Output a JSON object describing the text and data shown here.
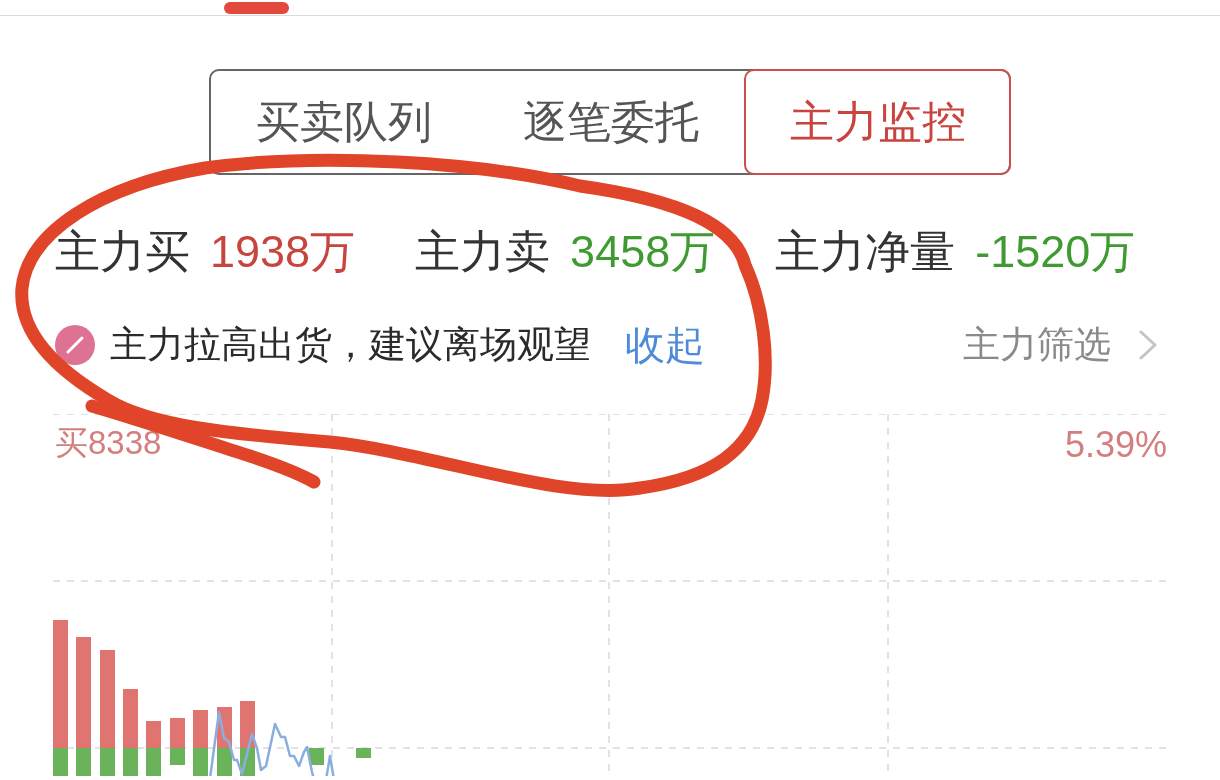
{
  "segmented_tabs": [
    {
      "label": "买卖队列",
      "selected": false
    },
    {
      "label": "逐笔委托",
      "selected": false
    },
    {
      "label": "主力监控",
      "selected": true
    }
  ],
  "summary": [
    {
      "label": "主力买",
      "value": "1938万",
      "color": "#c8453f"
    },
    {
      "label": "主力卖",
      "value": "3458万",
      "color": "#3f9a32"
    },
    {
      "label": "主力净量",
      "value": "-1520万",
      "color": "#3f9a32"
    }
  ],
  "alert": {
    "message": "主力拉高出货，建议离场观望",
    "collapse_link": "收起"
  },
  "filter": {
    "label": "主力筛选"
  },
  "chart": {
    "left_label": "买8338",
    "right_label": "5.39%"
  }
}
